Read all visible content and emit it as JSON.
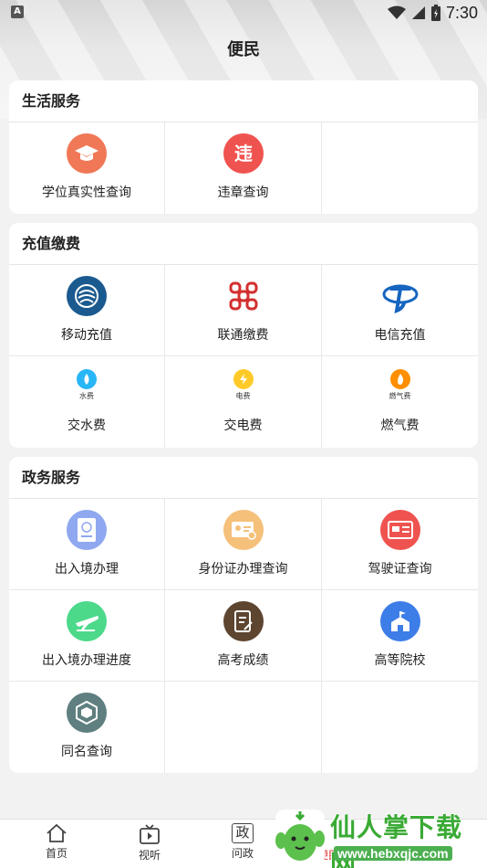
{
  "status": {
    "time": "7:30",
    "left_badge": "A"
  },
  "header": {
    "title": "便民"
  },
  "sections": {
    "life": {
      "title": "生活服务",
      "items": [
        {
          "label": "学位真实性查询",
          "icon": "graduation-cap-icon",
          "color": "#f07856"
        },
        {
          "label": "违章查询",
          "icon": "violation-icon",
          "color": "#ef5350"
        }
      ]
    },
    "recharge": {
      "title": "充值缴费",
      "items": [
        {
          "label": "移动充值",
          "icon": "china-mobile-logo",
          "color": "#1b5a8f"
        },
        {
          "label": "联通缴费",
          "icon": "china-unicom-logo",
          "color": "#d32f2f"
        },
        {
          "label": "电信充值",
          "icon": "china-telecom-logo",
          "color": "#1565c0"
        },
        {
          "label": "交水费",
          "icon": "water-icon",
          "tiny": "水费",
          "color": "#29b6f6"
        },
        {
          "label": "交电费",
          "icon": "electric-icon",
          "tiny": "电费",
          "color": "#ffca28"
        },
        {
          "label": "燃气费",
          "icon": "gas-icon",
          "tiny": "燃气费",
          "color": "#ff8f00"
        }
      ]
    },
    "gov": {
      "title": "政务服务",
      "items": [
        {
          "label": "出入境办理",
          "icon": "passport-icon",
          "color": "#8fa8f0"
        },
        {
          "label": "身份证办理查询",
          "icon": "id-card-icon",
          "color": "#f5c07a"
        },
        {
          "label": "驾驶证查询",
          "icon": "driver-license-icon",
          "color": "#ef5350"
        },
        {
          "label": "出入境办理进度",
          "icon": "plane-icon",
          "color": "#4cd98a"
        },
        {
          "label": "高考成绩",
          "icon": "exam-icon",
          "color": "#5d4530"
        },
        {
          "label": "高等院校",
          "icon": "school-icon",
          "color": "#3d7de8"
        },
        {
          "label": "同名查询",
          "icon": "same-name-icon",
          "color": "#5f7f80"
        }
      ]
    }
  },
  "bottom_nav": [
    {
      "label": "首页",
      "icon": "home-icon"
    },
    {
      "label": "视听",
      "icon": "tv-icon"
    },
    {
      "label": "问政",
      "icon": "zheng-icon",
      "glyph": "政"
    },
    {
      "label": "便民",
      "icon": "convenience-icon"
    }
  ],
  "watermark": {
    "title": "仙人掌下载网",
    "url": "www.hebxqjc.com"
  }
}
